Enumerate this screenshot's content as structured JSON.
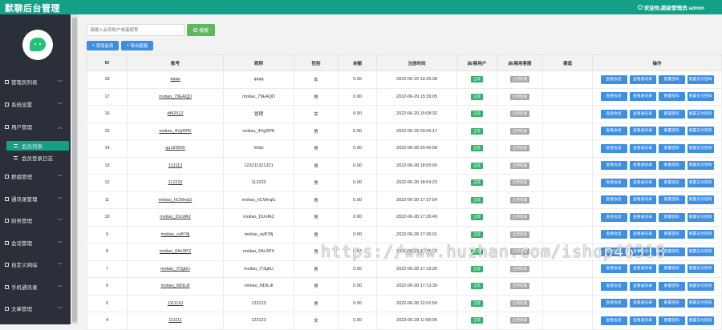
{
  "header": {
    "title": "默聊后台管理",
    "user_text": "欢迎你,超级管理员:admin"
  },
  "sidebar": {
    "items": [
      {
        "label": "管理员列表",
        "icon": "user-icon",
        "expanded": false
      },
      {
        "label": "系统设置",
        "icon": "gear-icon",
        "expanded": false
      },
      {
        "label": "用户管理",
        "icon": "users-icon",
        "expanded": true
      },
      {
        "label": "群组管理",
        "icon": "group-icon",
        "expanded": false
      },
      {
        "label": "通讯录管理",
        "icon": "edit-icon",
        "expanded": false
      },
      {
        "label": "财务管理",
        "icon": "edit-icon",
        "expanded": false
      },
      {
        "label": "会话管理",
        "icon": "chat-icon",
        "expanded": false
      },
      {
        "label": "自定义网站",
        "icon": "edit-icon",
        "expanded": false
      },
      {
        "label": "手机通讯录",
        "icon": "phone-icon",
        "expanded": false
      },
      {
        "label": "文章管理",
        "icon": "doc-icon",
        "expanded": false
      }
    ],
    "sub_items": [
      {
        "label": "会员列表",
        "active": true
      },
      {
        "label": "会员登录日志",
        "active": false
      }
    ]
  },
  "search": {
    "placeholder": "请输入会员账户或者昵称",
    "button_label": "搜索"
  },
  "actions": {
    "add_label": "添加会员",
    "export_label": "导出客服"
  },
  "table": {
    "columns": [
      "ID",
      "账号",
      "昵称",
      "性别",
      "余额",
      "注册时间",
      "启/禁用户",
      "启/禁用客服",
      "渠道",
      "操作"
    ],
    "op_labels": [
      "查看会话",
      "查看通讯录",
      "重置密码",
      "重置支付密码"
    ],
    "rows": [
      {
        "id": "18",
        "account": "qqqq",
        "nickname": "qqqq",
        "gender": "女",
        "balance": "0.00",
        "time": "2022-06-29 19:25:38",
        "user_status": "正常",
        "kefu_status": "启用客服",
        "channel": ""
      },
      {
        "id": "17",
        "account": "moliao_79EAQD",
        "nickname": "moliao_79EAQD",
        "gender": "男",
        "balance": "0.00",
        "time": "2022-06-29 15:39:05",
        "user_status": "正常",
        "kefu_status": "启用客服",
        "channel": ""
      },
      {
        "id": "16",
        "account": "df42512",
        "nickname": "管理",
        "gender": "女",
        "balance": "0.00",
        "time": "2022-06-29 15:08:32",
        "user_status": "正常",
        "kefu_status": "启用客服",
        "channel": ""
      },
      {
        "id": "15",
        "account": "moliao_4VgRPE",
        "nickname": "moliao_4VgRPE",
        "gender": "男",
        "balance": "0.00",
        "time": "2022-06-29 03:06:17",
        "user_status": "正常",
        "kefu_status": "启用客服",
        "channel": ""
      },
      {
        "id": "14",
        "account": "qq183900",
        "nickname": "hhbh",
        "gender": "男",
        "balance": "0.00",
        "time": "2022-06-28 20:40:58",
        "user_status": "正常",
        "kefu_status": "启用客服",
        "channel": ""
      },
      {
        "id": "13",
        "account": "113113",
        "nickname": "123211321321",
        "gender": "男",
        "balance": "0.00",
        "time": "2022-06-28 18:05:00",
        "user_status": "正常",
        "kefu_status": "启用客服",
        "channel": ""
      },
      {
        "id": "12",
        "account": "112233",
        "nickname": "112233",
        "gender": "男",
        "balance": "0.00",
        "time": "2022-06-28 18:04:23",
        "user_status": "正常",
        "kefu_status": "启用客服",
        "channel": ""
      },
      {
        "id": "11",
        "account": "moliao_hCWnqG",
        "nickname": "moliao_hCWnqG",
        "gender": "男",
        "balance": "0.00",
        "time": "2022-06-28 17:37:54",
        "user_status": "正常",
        "kefu_status": "启用客服",
        "channel": ""
      },
      {
        "id": "10",
        "account": "moliao_DUofA2",
        "nickname": "moliao_DUofA2",
        "gender": "男",
        "balance": "0.00",
        "time": "2022-06-28 17:26:49",
        "user_status": "正常",
        "kefu_status": "启用客服",
        "channel": ""
      },
      {
        "id": "9",
        "account": "moliao_vyB78j",
        "nickname": "moliao_vyB78j",
        "gender": "男",
        "balance": "0.00",
        "time": "2022-06-28 17:26:01",
        "user_status": "正常",
        "kefu_status": "启用客服",
        "channel": ""
      },
      {
        "id": "8",
        "account": "moliao_6Ax3PX",
        "nickname": "moliao_6Ax3PX",
        "gender": "男",
        "balance": "0.00",
        "time": "2022-06-28 17:25:23",
        "user_status": "正常",
        "kefu_status": "启用客服",
        "channel": ""
      },
      {
        "id": "7",
        "account": "moliao_I73gbU",
        "nickname": "moliao_I73gbU",
        "gender": "男",
        "balance": "0.00",
        "time": "2022-06-28 17:19:26",
        "user_status": "正常",
        "kefu_status": "启用客服",
        "channel": ""
      },
      {
        "id": "6",
        "account": "moliao_NDtLdl",
        "nickname": "moliao_NDtLdl",
        "gender": "男",
        "balance": "0.00",
        "time": "2022-06-28 17:13:39",
        "user_status": "正常",
        "kefu_status": "启用客服",
        "channel": ""
      },
      {
        "id": "5",
        "account": "1111110",
        "nickname": "123123",
        "gender": "男",
        "balance": "0.00",
        "time": "2022-06-28 12:01:50",
        "user_status": "正常",
        "kefu_status": "启用客服",
        "channel": ""
      },
      {
        "id": "4",
        "account": "111111",
        "nickname": "123123",
        "gender": "女",
        "balance": "0.00",
        "time": "2022-06-28 11:58:05",
        "user_status": "正常",
        "kefu_status": "启用客服",
        "channel": ""
      }
    ]
  },
  "watermark": "https://www.huzhan.com/ishop46318",
  "colors": {
    "brand": "#13a087",
    "sidebar": "#2b2f3a",
    "button_blue": "#3f8fe0",
    "search_green": "#5fb85f",
    "tag_green": "#33b26b"
  }
}
